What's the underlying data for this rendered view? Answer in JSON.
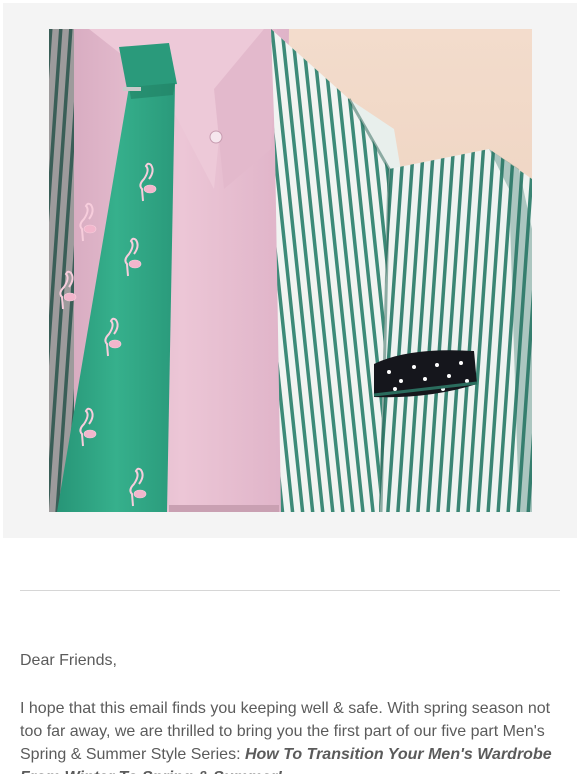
{
  "email": {
    "greeting": "Dear Friends,",
    "intro_paragraph": "I hope that this email finds you keeping well & safe. With spring season not too far away, we are thrilled to bring you the first part of our five part Men's Spring & Summer Style Series: ",
    "article_title": "How To Transition Your Men's Wardrobe From Winter To Spring & Summer!"
  },
  "colors": {
    "panel_background": "#f4f4f4",
    "body_text": "#5b5b5b",
    "divider": "#d6d6d6",
    "tie_green": "#2fa886",
    "shirt_pink": "#e8c0d1",
    "jacket_stripe": "#3d8a78"
  }
}
